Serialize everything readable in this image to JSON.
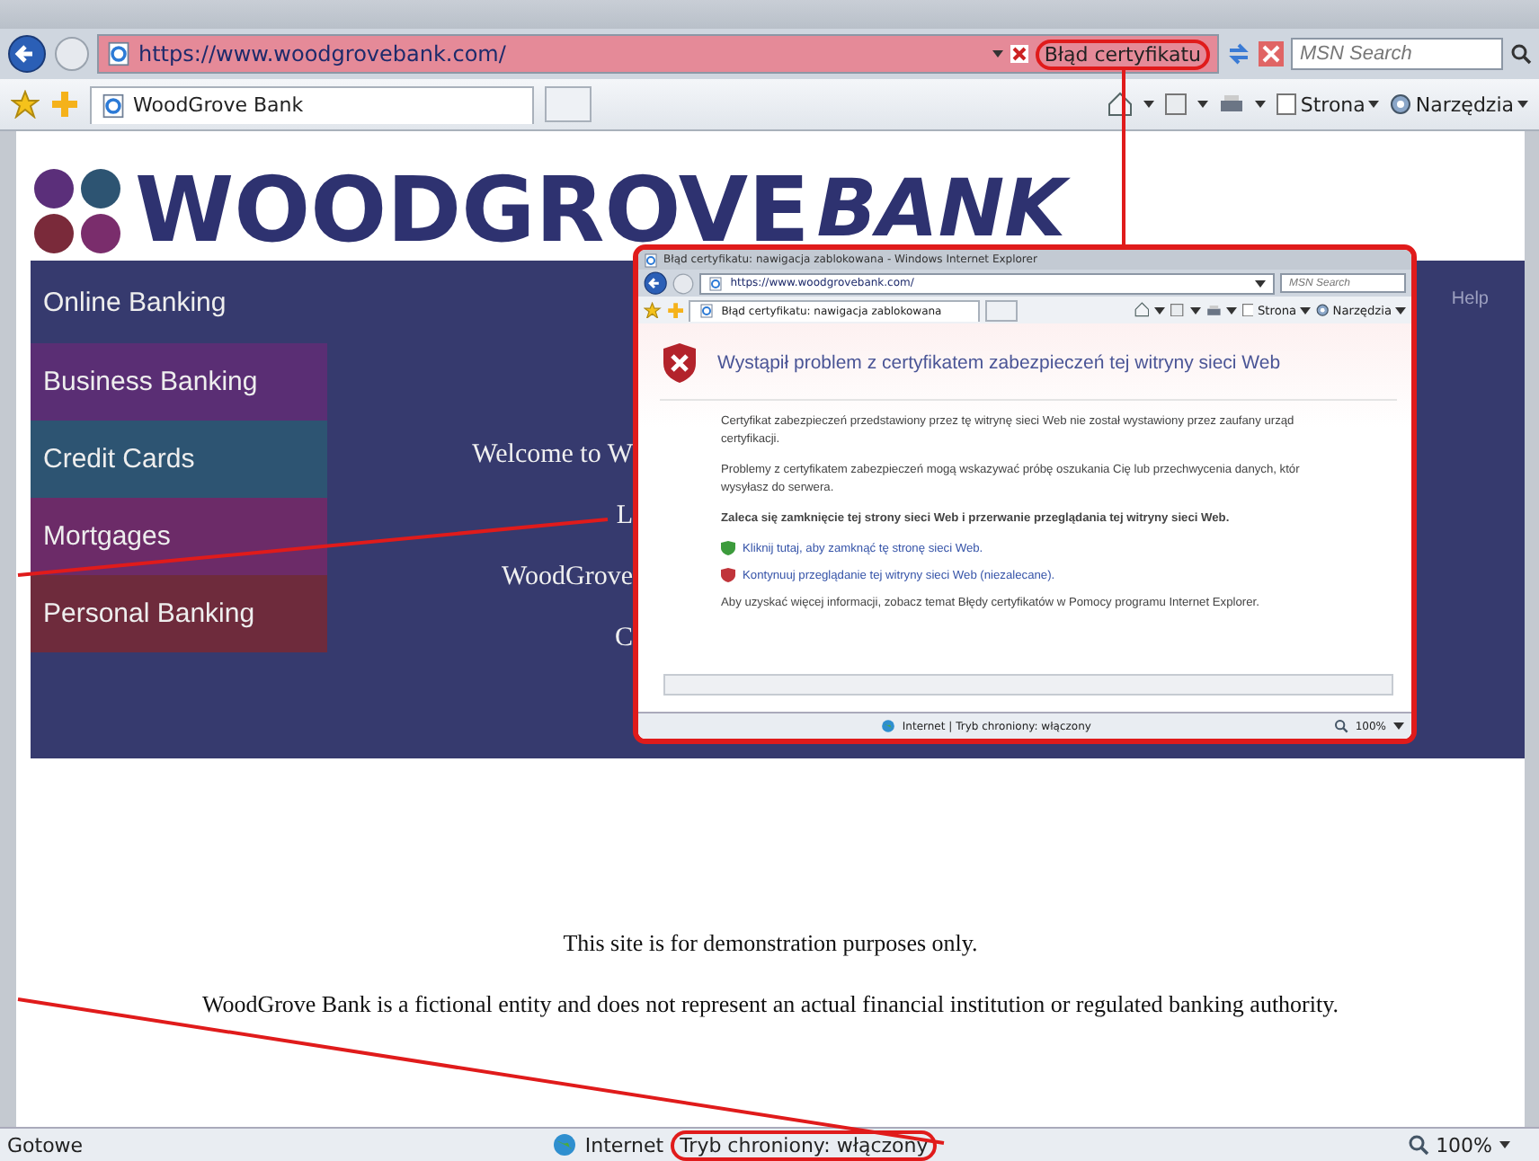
{
  "browser": {
    "url": "https://www.woodgrovebank.com/",
    "certificate_error": "Błąd certyfikatu",
    "search": {
      "placeholder": "MSN Search"
    },
    "tab": "WoodGrove Bank",
    "commands": [
      "Strona",
      "Narzędzia"
    ]
  },
  "page": {
    "logo": {
      "word": "WOODGROVE",
      "word_italic": "BANK"
    },
    "nav": [
      {
        "label": "Online Banking",
        "color": "#363a6e"
      },
      {
        "label": "Business Banking",
        "color": "#5a2e74"
      },
      {
        "label": "Credit Cards",
        "color": "#2d5472"
      },
      {
        "label": "Mortgages",
        "color": "#6c2b68"
      },
      {
        "label": "Personal Banking",
        "color": "#6e2b3c"
      }
    ],
    "welcome_lines": [
      "Welcome to W",
      "L",
      "WoodGrove",
      "C"
    ],
    "help": "Help",
    "notes": [
      "This site is for demonstration purposes only.",
      "WoodGrove Bank is a fictional entity and does not represent an actual financial institution or regulated banking authority."
    ]
  },
  "status_bar": {
    "text": "Gotowe",
    "zone": "Internet",
    "protected_mode": "Tryb chroniony: włączony",
    "zoom": "100%"
  },
  "inset": {
    "title": "Błąd certyfikatu: nawigacja zablokowana - Windows Internet Explorer",
    "url": "https://www.woodgrovebank.com/",
    "search": {
      "placeholder": "MSN Search"
    },
    "tab": "Błąd certyfikatu: nawigacja zablokowana",
    "commands": [
      "Strona",
      "Narzędzia"
    ],
    "heading": "Wystąpił problem z certyfikatem zabezpieczeń tej witryny sieci Web",
    "paragraphs": [
      [
        "Certyfikat zabezpieczeń przedstawiony przez tę witrynę sieci Web nie został wystawiony przez zaufany urząd",
        "certyfikacji."
      ],
      [
        "Problemy z certyfikatem zabezpieczeń mogą wskazywać próbę oszukania Cię lub przechwycenia danych, któr",
        "wysyłasz do serwera."
      ]
    ],
    "recommendation": "Zaleca się zamknięcie tej strony sieci Web i przerwanie przeglądania tej witryny sieci Web.",
    "links": [
      {
        "label": "Kliknij tutaj, aby zamknąć tę stronę sieci Web.",
        "kind": "safe"
      },
      {
        "label": "Kontynuuj przeglądanie tej witryny sieci Web (niezalecane).",
        "kind": "unsafe"
      }
    ],
    "info": "Aby uzyskać więcej informacji, zobacz temat Błędy certyfikatów w Pomocy programu Internet Explorer.",
    "status": "Internet | Tryb chroniony: włączony",
    "zoom": "100%"
  }
}
